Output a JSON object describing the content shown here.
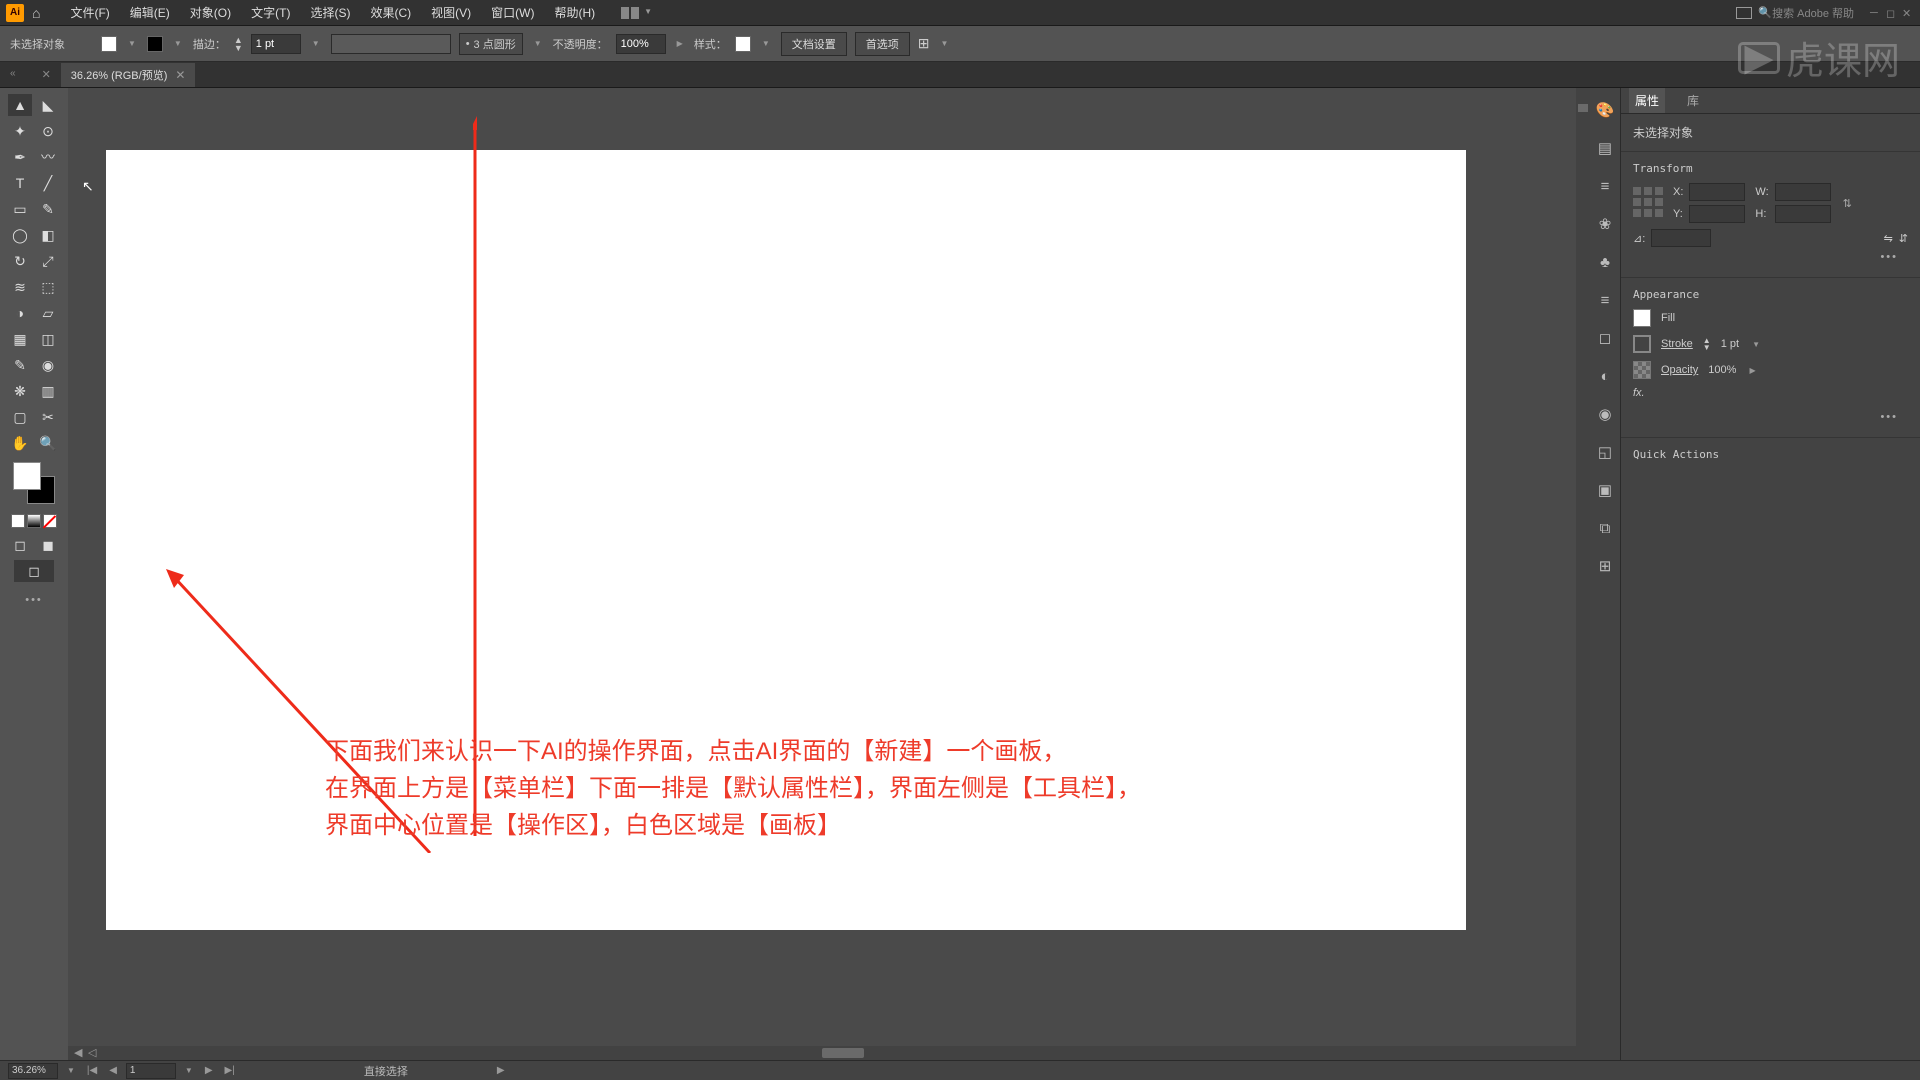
{
  "app": {
    "icon_label": "Ai"
  },
  "menubar": {
    "items": [
      "文件(F)",
      "编辑(E)",
      "对象(O)",
      "文字(T)",
      "选择(S)",
      "效果(C)",
      "视图(V)",
      "窗口(W)",
      "帮助(H)"
    ],
    "search_placeholder": "搜索 Adobe 帮助"
  },
  "controlbar": {
    "no_selection": "未选择对象",
    "stroke_label": "描边：",
    "stroke_value": "1 pt",
    "shape_value": "3 点圆形",
    "opacity_label": "不透明度：",
    "opacity_value": "100%",
    "style_label": "样式：",
    "doc_setup": "文档设置",
    "prefs": "首选项"
  },
  "tab": {
    "title": "36.26% (RGB/预览)"
  },
  "annotation": {
    "line1": "下面我们来认识一下AI的操作界面，点击AI界面的【新建】一个画板，",
    "line2": "在界面上方是【菜单栏】下面一排是【默认属性栏】，界面左侧是【工具栏】，",
    "line3": "界面中心位置是【操作区】，白色区域是【画板】"
  },
  "properties": {
    "tab_props": "属性",
    "tab_lib": "库",
    "no_selection": "未选择对象",
    "transform": "Transform",
    "x_label": "X:",
    "y_label": "Y:",
    "w_label": "W:",
    "h_label": "H:",
    "angle_label": "⊿:",
    "appearance": "Appearance",
    "fill": "Fill",
    "stroke": "Stroke",
    "stroke_val": "1 pt",
    "opacity": "Opacity",
    "opacity_val": "100%",
    "fx": "fx.",
    "quick": "Quick Actions"
  },
  "statusbar": {
    "zoom": "36.26%",
    "page": "1",
    "tool": "直接选择"
  },
  "watermark": {
    "text": "虎课网"
  }
}
